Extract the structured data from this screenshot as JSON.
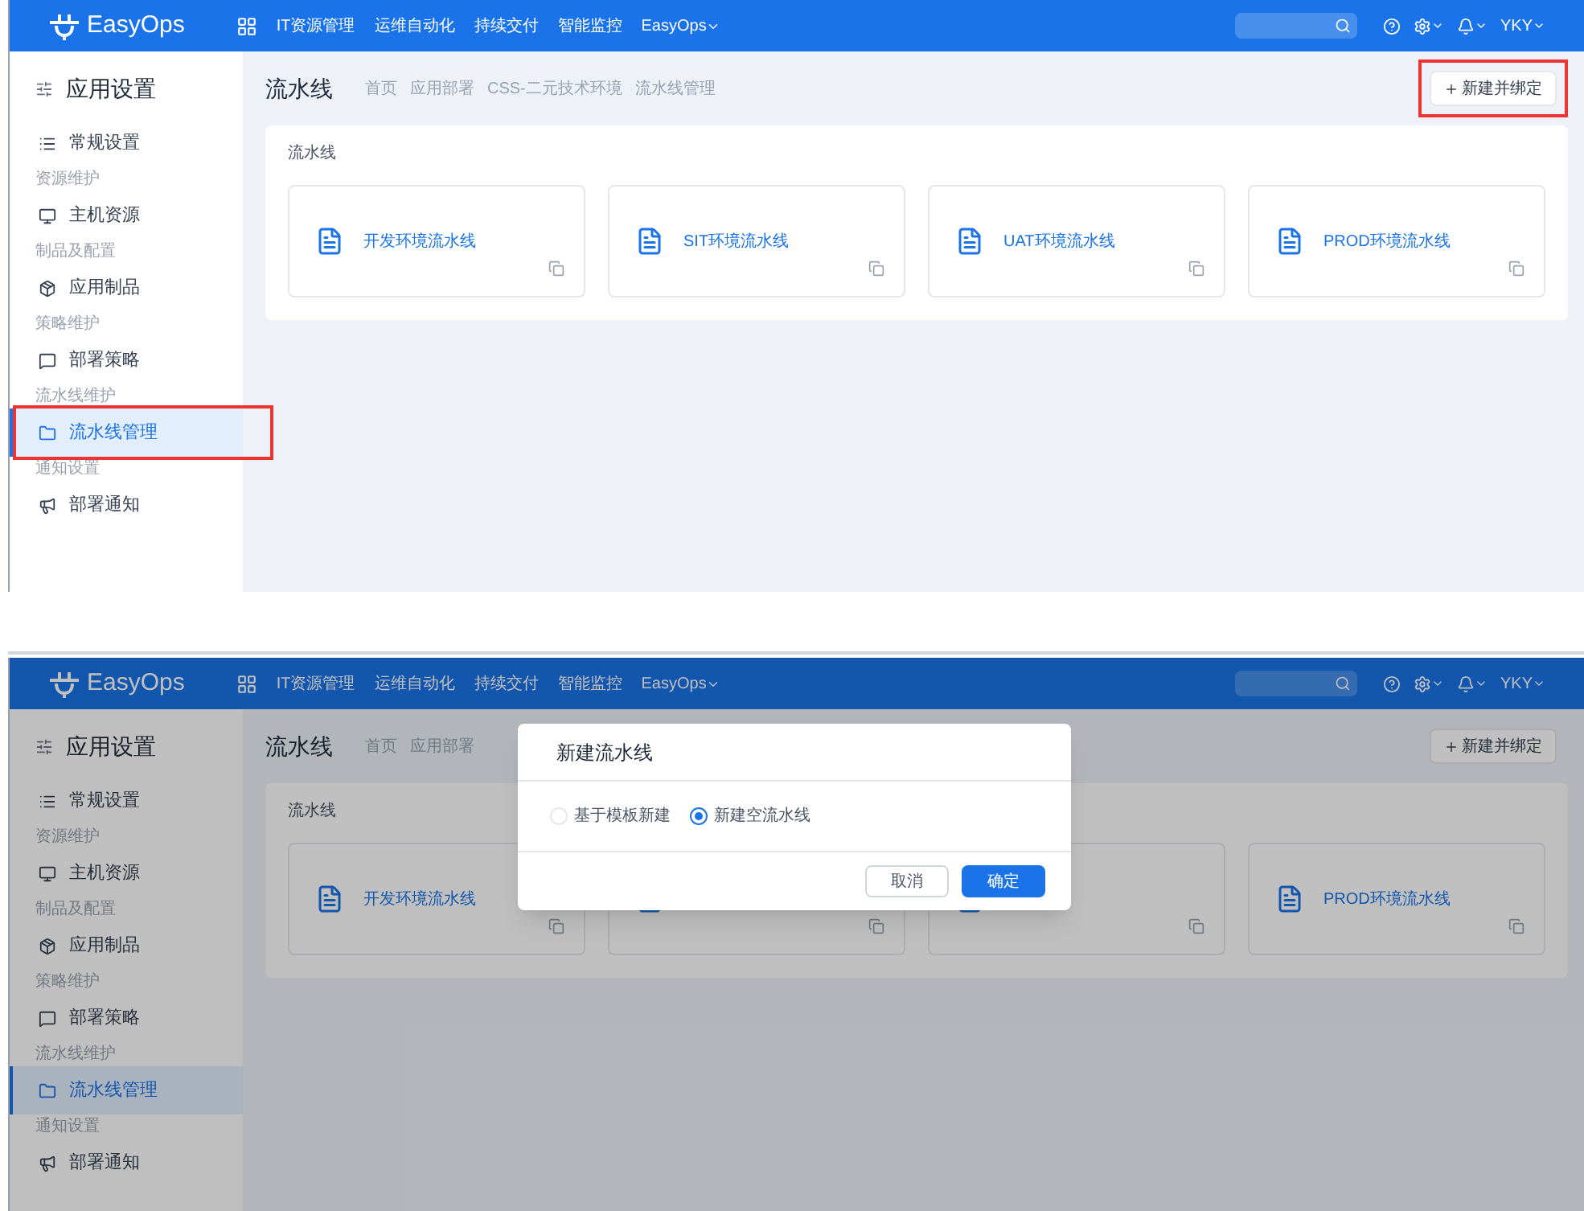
{
  "screens": [
    {
      "header": {
        "logo": "EasyOps",
        "nav": [
          "IT资源管理",
          "运维自动化",
          "持续交付",
          "智能监控",
          "EasyOps"
        ],
        "user": "YKY"
      },
      "sidebar": {
        "title": "应用设置",
        "items": [
          {
            "kind": "item",
            "label": "常规设置",
            "selected": false,
            "highlighted": false
          },
          {
            "kind": "group",
            "label": "资源维护"
          },
          {
            "kind": "item",
            "label": "主机资源",
            "selected": false,
            "highlighted": false
          },
          {
            "kind": "group",
            "label": "制品及配置"
          },
          {
            "kind": "item",
            "label": "应用制品",
            "selected": false,
            "highlighted": false
          },
          {
            "kind": "group",
            "label": "策略维护"
          },
          {
            "kind": "item",
            "label": "部署策略",
            "selected": false,
            "highlighted": false
          },
          {
            "kind": "group",
            "label": "流水线维护"
          },
          {
            "kind": "item",
            "label": "流水线管理",
            "selected": true,
            "highlighted": true
          },
          {
            "kind": "group",
            "label": "通知设置"
          },
          {
            "kind": "item",
            "label": "部署通知",
            "selected": false,
            "highlighted": false
          }
        ]
      },
      "page_title": "流水线",
      "breadcrumb": [
        "首页",
        "应用部署",
        "CSS-二元技术环境",
        "流水线管理"
      ],
      "new_button": {
        "label": "新建并绑定",
        "highlighted": true
      },
      "section_title": "流水线",
      "cards": [
        {
          "kind": "card",
          "label": "开发环境流水线"
        },
        {
          "kind": "card",
          "label": "SIT环境流水线"
        },
        {
          "kind": "card",
          "label": "UAT环境流水线"
        },
        {
          "kind": "card",
          "label": "PROD环境流水线"
        }
      ]
    },
    {
      "header": {
        "logo": "EasyOps",
        "nav": [
          "IT资源管理",
          "运维自动化",
          "持续交付",
          "智能监控",
          "EasyOps"
        ],
        "user": "YKY"
      },
      "sidebar": {
        "title": "应用设置",
        "items": [
          {
            "kind": "item",
            "label": "常规设置",
            "selected": false,
            "highlighted": false
          },
          {
            "kind": "group",
            "label": "资源维护"
          },
          {
            "kind": "item",
            "label": "主机资源",
            "selected": false,
            "highlighted": false
          },
          {
            "kind": "group",
            "label": "制品及配置"
          },
          {
            "kind": "item",
            "label": "应用制品",
            "selected": false,
            "highlighted": false
          },
          {
            "kind": "group",
            "label": "策略维护"
          },
          {
            "kind": "item",
            "label": "部署策略",
            "selected": false,
            "highlighted": false
          },
          {
            "kind": "group",
            "label": "流水线维护"
          },
          {
            "kind": "item",
            "label": "流水线管理",
            "selected": true,
            "highlighted": false
          },
          {
            "kind": "group",
            "label": "通知设置"
          },
          {
            "kind": "item",
            "label": "部署通知",
            "selected": false,
            "highlighted": false
          }
        ]
      },
      "page_title": "流水线",
      "breadcrumb": [
        "首页",
        "应用部署"
      ],
      "new_button": {
        "label": "新建并绑定",
        "highlighted": false
      },
      "section_title": "流水线",
      "cards": [
        {
          "kind": "card",
          "label": "开发环境流水线"
        },
        {
          "kind": "covered_card"
        },
        {
          "kind": "covered_card"
        },
        {
          "kind": "card",
          "label": "PROD环境流水线"
        }
      ],
      "dialog": {
        "title": "新建流水线",
        "options": [
          {
            "label": "基于模板新建",
            "selected": false
          },
          {
            "label": "新建空流水线",
            "selected": true
          }
        ],
        "cancel": "取消",
        "ok": "确定"
      }
    }
  ]
}
